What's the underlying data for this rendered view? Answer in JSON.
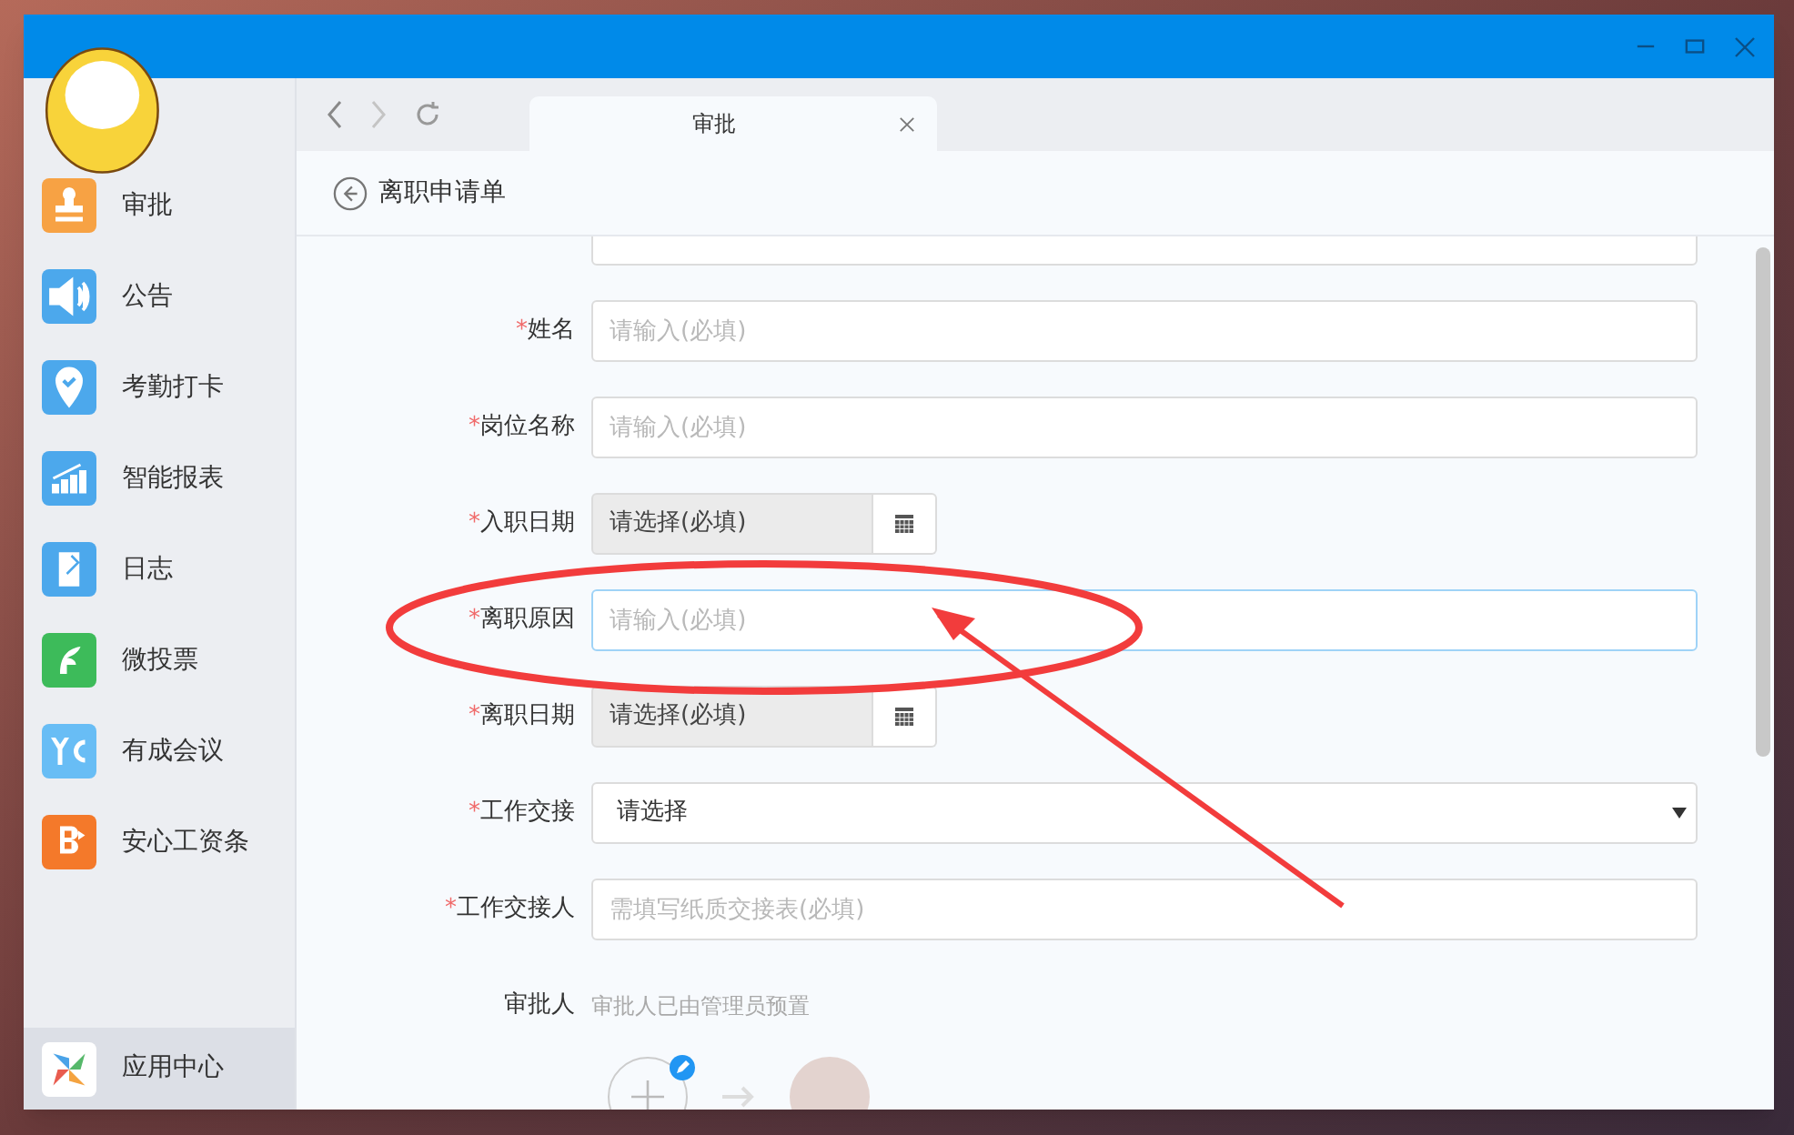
{
  "sidebar": {
    "items": [
      {
        "label": "审批",
        "color": "#f7a244",
        "selected": false
      },
      {
        "label": "公告",
        "color": "#4ca8ec",
        "selected": false
      },
      {
        "label": "考勤打卡",
        "color": "#4ca8ec",
        "selected": false
      },
      {
        "label": "智能报表",
        "color": "#4ca8ec",
        "selected": false
      },
      {
        "label": "日志",
        "color": "#4ca8ec",
        "selected": false
      },
      {
        "label": "微投票",
        "color": "#3dbb5a",
        "selected": false
      },
      {
        "label": "有成会议",
        "color": "#68bdf5",
        "selected": false
      },
      {
        "label": "安心工资条",
        "color": "#f4792a",
        "selected": false
      }
    ],
    "bottom": {
      "label": "应用中心",
      "selected": true
    }
  },
  "tabs": [
    {
      "label": "审批",
      "selected": true
    }
  ],
  "page": {
    "title": "离职申请单"
  },
  "form": {
    "fields": [
      {
        "kind": "text",
        "marker": "*",
        "label": "姓名",
        "placeholder": "请输入(必填)",
        "focused": false
      },
      {
        "kind": "text",
        "marker": "*",
        "label": "岗位名称",
        "placeholder": "请输入(必填)",
        "focused": false
      },
      {
        "kind": "date",
        "marker": "*",
        "label": "入职日期",
        "value": "请选择(必填)"
      },
      {
        "kind": "text",
        "marker": "*",
        "label": "离职原因",
        "placeholder": "请输入(必填)",
        "focused": true
      },
      {
        "kind": "date",
        "marker": "*",
        "label": "离职日期",
        "value": "请选择(必填)"
      },
      {
        "kind": "select",
        "marker": "*",
        "label": "工作交接",
        "value": "请选择"
      },
      {
        "kind": "text",
        "marker": "*",
        "label": "工作交接人",
        "placeholder": "需填写纸质交接表(必填)",
        "focused": false
      },
      {
        "kind": "note",
        "label": "审批人",
        "value": "审批人已由管理员预置"
      }
    ]
  }
}
